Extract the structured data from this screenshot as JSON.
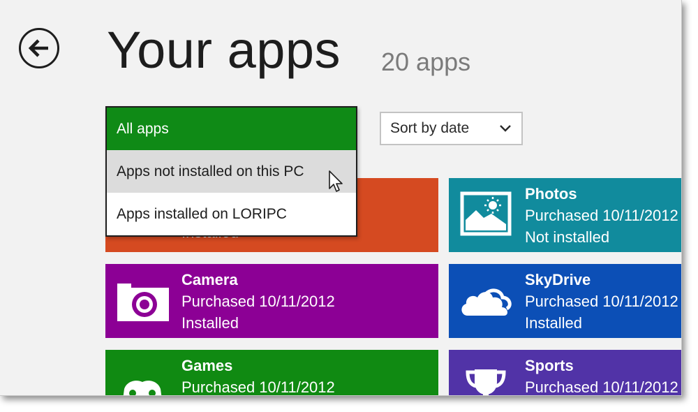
{
  "header": {
    "title": "Your apps",
    "app_count": "20 apps"
  },
  "filter_dropdown": {
    "options": [
      {
        "label": "All apps",
        "state": "selected"
      },
      {
        "label": "Apps not installed on this PC",
        "state": "hover"
      },
      {
        "label": "Apps installed on LORIPC",
        "state": "normal"
      }
    ]
  },
  "sort": {
    "label": "Sort by date"
  },
  "tiles": [
    {
      "name": "",
      "line1": "",
      "line2": "Installed",
      "color": "#d54a21",
      "icon": "hidden"
    },
    {
      "name": "Photos",
      "line1": "Purchased 10/11/2012",
      "line2": "Not installed",
      "color": "#118b9d",
      "icon": "photos-icon"
    },
    {
      "name": "Camera",
      "line1": "Purchased 10/11/2012",
      "line2": "Installed",
      "color": "#8c0095",
      "icon": "camera-icon"
    },
    {
      "name": "SkyDrive",
      "line1": "Purchased 10/11/2012",
      "line2": "Installed",
      "color": "#0c4fb6",
      "icon": "cloud-icon"
    },
    {
      "name": "Games",
      "line1": "Purchased 10/11/2012",
      "line2": "",
      "color": "#108a12",
      "icon": "controller-icon"
    },
    {
      "name": "Sports",
      "line1": "Purchased 10/11/2012",
      "line2": "",
      "color": "#5133a7",
      "icon": "trophy-icon"
    }
  ]
}
